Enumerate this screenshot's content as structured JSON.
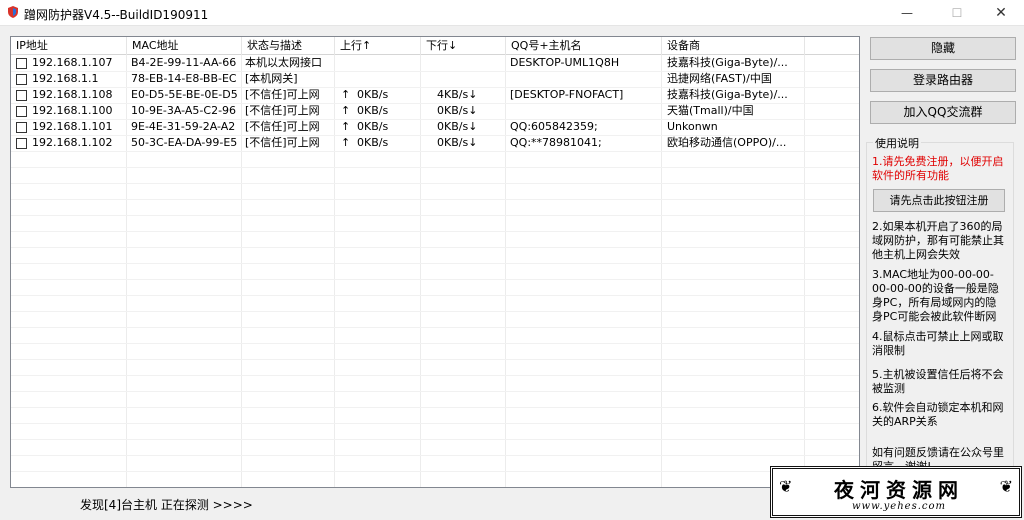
{
  "window": {
    "title": "蹭网防护器V4.5--BuildID190911",
    "minimize": "—",
    "maximize": "☐",
    "close": "✕"
  },
  "table": {
    "columns": [
      "IP地址",
      "MAC地址",
      "状态与描述",
      "上行↑",
      "下行↓",
      "QQ号+主机名",
      "设备商"
    ],
    "rows": [
      {
        "ip": "192.168.1.107",
        "mac": "B4-2E-99-11-AA-66",
        "status": "本机以太网接口",
        "up_arrow": "",
        "up": "",
        "down": "",
        "host": "DESKTOP-UML1Q8H",
        "vendor": "技嘉科技(Giga-Byte)/..."
      },
      {
        "ip": "192.168.1.1",
        "mac": "78-EB-14-E8-BB-EC",
        "status": "[本机网关]",
        "up_arrow": "",
        "up": "",
        "down": "",
        "host": "",
        "vendor": "迅捷网络(FAST)/中国"
      },
      {
        "ip": "192.168.1.108",
        "mac": "E0-D5-5E-BE-0E-D5",
        "status": "[不信任]可上网",
        "up_arrow": "↑",
        "up": "0KB/s",
        "down": "4KB/s↓",
        "host": "[DESKTOP-FNOFACT]",
        "vendor": "技嘉科技(Giga-Byte)/..."
      },
      {
        "ip": "192.168.1.100",
        "mac": "10-9E-3A-A5-C2-96",
        "status": "[不信任]可上网",
        "up_arrow": "↑",
        "up": "0KB/s",
        "down": "0KB/s↓",
        "host": "",
        "vendor": "天猫(Tmall)/中国"
      },
      {
        "ip": "192.168.1.101",
        "mac": "9E-4E-31-59-2A-A2",
        "status": "[不信任]可上网",
        "up_arrow": "↑",
        "up": "0KB/s",
        "down": "0KB/s↓",
        "host": "QQ:605842359;",
        "vendor": "Unkonwn"
      },
      {
        "ip": "192.168.1.102",
        "mac": "50-3C-EA-DA-99-E5",
        "status": "[不信任]可上网",
        "up_arrow": "↑",
        "up": "0KB/s",
        "down": "0KB/s↓",
        "host": "QQ:**78981041;",
        "vendor": "欧珀移动通信(OPPO)/..."
      }
    ]
  },
  "side": {
    "hide_button": "隐藏",
    "router_button": "登录路由器",
    "qq_group_button": "加入QQ交流群",
    "group_title": "使用说明",
    "note1": "1.请先免费注册，以便开启软件的所有功能",
    "register_button": "请先点击此按钮注册",
    "note2": "2.如果本机开启了360的局域网防护，那有可能禁止其他主机上网会失效",
    "note3": "3.MAC地址为00-00-00-00-00-00的设备一般是隐身PC，所有局域网内的隐身PC可能会被此软件断网",
    "note4": "4.鼠标点击可禁止上网或取消限制",
    "note5": "5.主机被设置信任后将不会被监测",
    "note6": "6.软件会自动锁定本机和网关的ARP关系",
    "note7": "如有问题反馈请在公众号里留言，谢谢!"
  },
  "status_bar": {
    "text": "发现[4]台主机  正在探测 >>>>"
  },
  "watermark": {
    "title": "夜河资源网",
    "url": "www.yehes.com"
  },
  "colors": {
    "red_note": "#e00000"
  }
}
